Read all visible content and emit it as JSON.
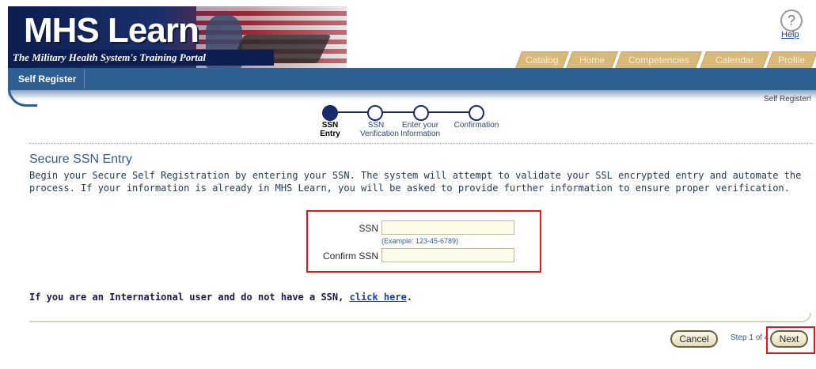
{
  "banner": {
    "logo": "MHS Learn",
    "tagline": "The Military Health System's Training Portal"
  },
  "help": {
    "label": "Help",
    "icon": "question-circle-icon"
  },
  "tabs": [
    "Catalog",
    "Home",
    "Competencies",
    "Calendar",
    "Profile"
  ],
  "nav": {
    "current": "Self Register",
    "crumb": "Self Register!"
  },
  "steps": [
    {
      "label": "SSN Entry",
      "state": "current"
    },
    {
      "label": "SSN Verification",
      "state": "todo"
    },
    {
      "label": "Enter your Information",
      "state": "todo"
    },
    {
      "label": "Confirmation",
      "state": "todo"
    }
  ],
  "section": {
    "title": "Secure SSN Entry",
    "intro": "Begin your Secure Self Registration by entering your SSN. The system will attempt to validate your SSL encrypted entry and automate the process. If your information is already in MHS Learn, you will be asked to provide further information to ensure proper verification."
  },
  "form": {
    "ssn_label": "SSN",
    "ssn_value": "",
    "ssn_example": "(Example: 123-45-6789)",
    "confirm_label": "Confirm SSN",
    "confirm_value": ""
  },
  "international": {
    "text": "If you are an International user and do not have a SSN, ",
    "link": "click here",
    "suffix": "."
  },
  "footer": {
    "cancel": "Cancel",
    "step": "Step 1 of 4",
    "next": "Next"
  },
  "colors": {
    "nav_blue": "#2d5f91",
    "tab_tan": "#d9b978",
    "highlight": "#e01818"
  }
}
